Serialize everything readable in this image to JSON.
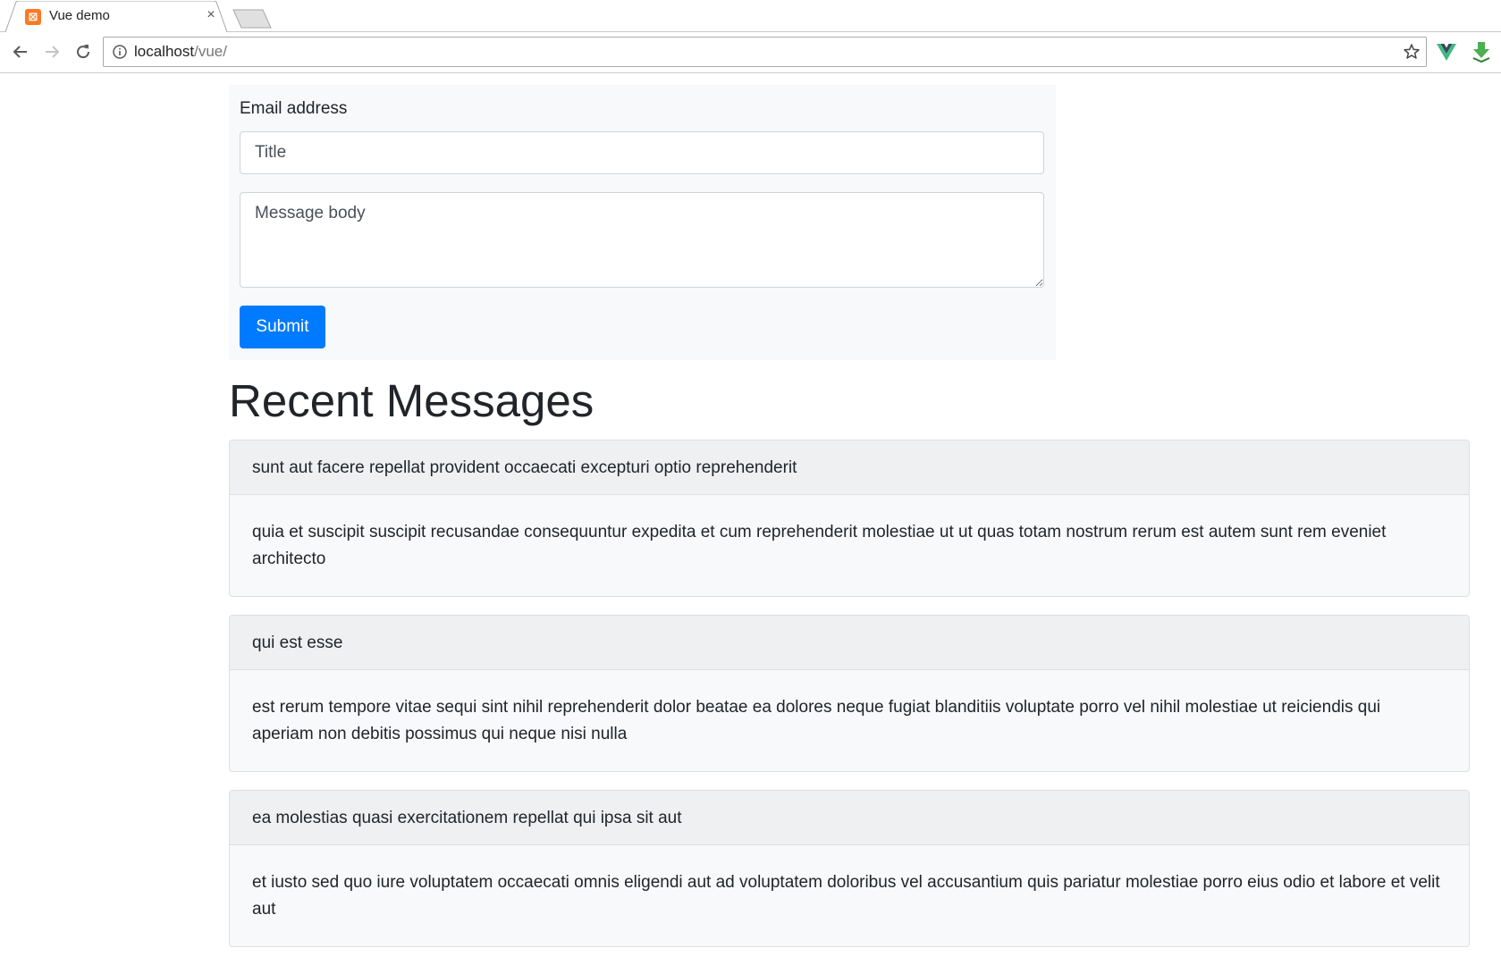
{
  "browser": {
    "tab_title": "Vue demo",
    "tab_close": "×",
    "favicon_glyph": "⊠",
    "url_host": "localhost",
    "url_path": "/vue/"
  },
  "form": {
    "label": "Email address",
    "title_placeholder": "Title",
    "title_value": "",
    "body_placeholder": "Message body",
    "body_value": "",
    "submit_label": "Submit"
  },
  "recent": {
    "heading": "Recent Messages",
    "messages": [
      {
        "title": "sunt aut facere repellat provident occaecati excepturi optio reprehenderit",
        "body": "quia et suscipit suscipit recusandae consequuntur expedita et cum reprehenderit molestiae ut ut quas totam nostrum rerum est autem sunt rem eveniet architecto"
      },
      {
        "title": "qui est esse",
        "body": "est rerum tempore vitae sequi sint nihil reprehenderit dolor beatae ea dolores neque fugiat blanditiis voluptate porro vel nihil molestiae ut reiciendis qui aperiam non debitis possimus qui neque nisi nulla"
      },
      {
        "title": "ea molestias quasi exercitationem repellat qui ipsa sit aut",
        "body": "et iusto sed quo iure voluptatem occaecati omnis eligendi aut ad voluptatem doloribus vel accusantium quis pariatur molestiae porro eius odio et labore et velit aut"
      }
    ]
  },
  "colors": {
    "primary": "#007bff",
    "panel_bg": "#f8f9fa",
    "card_header_bg": "#eff0f2",
    "vue_green": "#41b883",
    "download_green": "#4caf50",
    "favicon_orange": "#fb7a24"
  },
  "icons": {
    "back": "arrow-left-icon",
    "forward": "arrow-right-icon",
    "reload": "reload-icon",
    "info": "info-icon",
    "star": "star-icon",
    "vue_devtools": "vue-devtools-icon",
    "download": "download-icon"
  }
}
